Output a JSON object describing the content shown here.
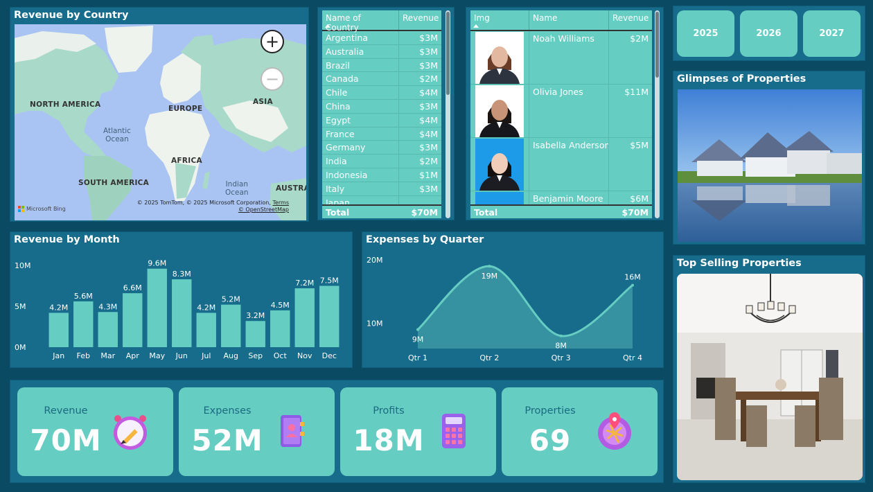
{
  "map": {
    "title": "Revenue by Country",
    "labels": {
      "north_america": "NORTH AMERICA",
      "europe": "EUROPE",
      "asia": "ASIA",
      "africa": "AFRICA",
      "south_america": "SOUTH AMERICA",
      "australia": "AUSTRA",
      "atlantic": "Atlantic\nOcean",
      "indian": "Indian\nOcean"
    },
    "attribution_line1": "© 2025 TomTom, © 2025 Microsoft Corporation,",
    "attribution_terms": "Terms",
    "attribution_line2": "© OpenStreetMap",
    "bing_label": "Microsoft Bing",
    "zoom_in": "+",
    "zoom_out": "−"
  },
  "country_table": {
    "headers": [
      "Name of Country",
      "Revenue"
    ],
    "rows": [
      [
        "Argentina",
        "$3M"
      ],
      [
        "Australia",
        "$3M"
      ],
      [
        "Brazil",
        "$3M"
      ],
      [
        "Canada",
        "$2M"
      ],
      [
        "Chile",
        "$4M"
      ],
      [
        "China",
        "$3M"
      ],
      [
        "Egypt",
        "$4M"
      ],
      [
        "France",
        "$4M"
      ],
      [
        "Germany",
        "$3M"
      ],
      [
        "India",
        "$2M"
      ],
      [
        "Indonesia",
        "$1M"
      ],
      [
        "Italy",
        "$3M"
      ],
      [
        "Japan",
        ""
      ]
    ],
    "total_label": "Total",
    "total_value": "$70M"
  },
  "people_table": {
    "headers": [
      "Img",
      "Name",
      "Revenue"
    ],
    "rows": [
      {
        "name": "Noah Williams",
        "revenue": "$2M",
        "bg": "#ffffff",
        "shirt": "#2d3440",
        "skin": "#e2b9a0",
        "hair": "#6b3d28"
      },
      {
        "name": "Olivia Jones",
        "revenue": "$11M",
        "bg": "#ffffff",
        "shirt": "#15171c",
        "skin": "#c89478",
        "hair": "#1a1412"
      },
      {
        "name": "Isabella Anderson",
        "revenue": "$5M",
        "bg": "#1e9be8",
        "shirt": "#1b1d22",
        "skin": "#efcdb8",
        "hair": "#141010"
      },
      {
        "name": "Benjamin Moore",
        "revenue": "$6M",
        "bg": "#1e9be8",
        "shirt": "#1b1d22",
        "skin": "#efcdb8",
        "hair": "#141010"
      }
    ],
    "total_label": "Total",
    "total_value": "$70M"
  },
  "years": [
    "2025",
    "2026",
    "2027"
  ],
  "glimpses": {
    "title": "Glimpses of Properties"
  },
  "top_selling": {
    "title": "Top Selling Properties"
  },
  "chart_data": [
    {
      "type": "bar",
      "title": "Revenue by Month",
      "categories": [
        "Jan",
        "Feb",
        "Mar",
        "Apr",
        "May",
        "Jun",
        "Jul",
        "Aug",
        "Sep",
        "Oct",
        "Nov",
        "Dec"
      ],
      "values": [
        4.2,
        5.6,
        4.3,
        6.6,
        9.6,
        8.3,
        4.2,
        5.2,
        3.2,
        4.5,
        7.2,
        7.5
      ],
      "data_labels": [
        "4.2M",
        "5.6M",
        "4.3M",
        "6.6M",
        "9.6M",
        "8.3M",
        "4.2M",
        "5.2M",
        "3.2M",
        "4.5M",
        "7.2M",
        "7.5M"
      ],
      "ylim": [
        0,
        10
      ],
      "yticks": [
        0,
        5,
        10
      ],
      "ytick_labels": [
        "0M",
        "5M",
        "10M"
      ],
      "grid": false,
      "color": "#66cdc3"
    },
    {
      "type": "area",
      "title": "Expenses by Quarter",
      "categories": [
        "Qtr 1",
        "Qtr 2",
        "Qtr 3",
        "Qtr 4"
      ],
      "values": [
        9,
        19,
        8,
        16
      ],
      "data_labels": [
        "9M",
        "19M",
        "8M",
        "16M"
      ],
      "ylim": [
        0,
        20
      ],
      "ytick_labels": [
        "10M",
        "20M"
      ],
      "yticks": [
        10,
        20
      ],
      "grid": false,
      "color": "#66cdc3"
    }
  ],
  "kpis": [
    {
      "label": "Revenue",
      "value": "70M",
      "icon": "clock-pencil-icon"
    },
    {
      "label": "Expenses",
      "value": "52M",
      "icon": "contact-book-icon"
    },
    {
      "label": "Profits",
      "value": "18M",
      "icon": "calculator-icon"
    },
    {
      "label": "Properties",
      "value": "69",
      "icon": "map-pin-icon"
    }
  ],
  "colors": {
    "background": "#0b4a63",
    "panel": "#166c8a",
    "accent": "#66cdc3",
    "kpi_label": "#1b6a80"
  }
}
